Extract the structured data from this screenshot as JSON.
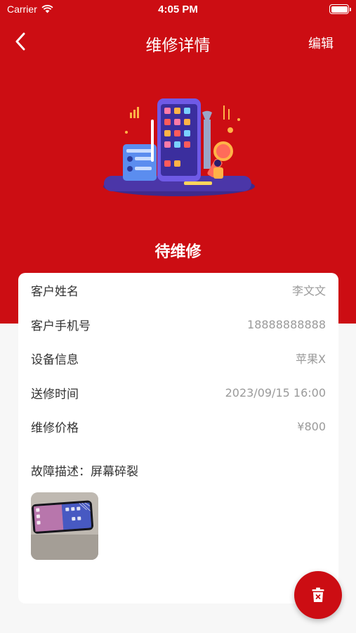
{
  "status_bar": {
    "carrier": "Carrier",
    "time": "4:05 PM"
  },
  "nav": {
    "title": "维修详情",
    "edit_label": "编辑"
  },
  "repair": {
    "status": "待维修",
    "fields": [
      {
        "label": "客户姓名",
        "value": "李文文"
      },
      {
        "label": "客户手机号",
        "value": "18888888888"
      },
      {
        "label": "设备信息",
        "value": "苹果X"
      },
      {
        "label": "送修时间",
        "value": "2023/09/15 16:00"
      },
      {
        "label": "维修价格",
        "value": "¥800"
      }
    ],
    "fault_text": "故障描述：屏幕碎裂"
  },
  "colors": {
    "primary": "#cc0d13",
    "background": "#f7f7f7",
    "card": "#ffffff",
    "label": "#333333",
    "value": "#9a9a9a"
  },
  "icons": {
    "back": "chevron-left-icon",
    "wifi": "wifi-icon",
    "battery": "battery-icon",
    "delete": "trash-icon"
  }
}
